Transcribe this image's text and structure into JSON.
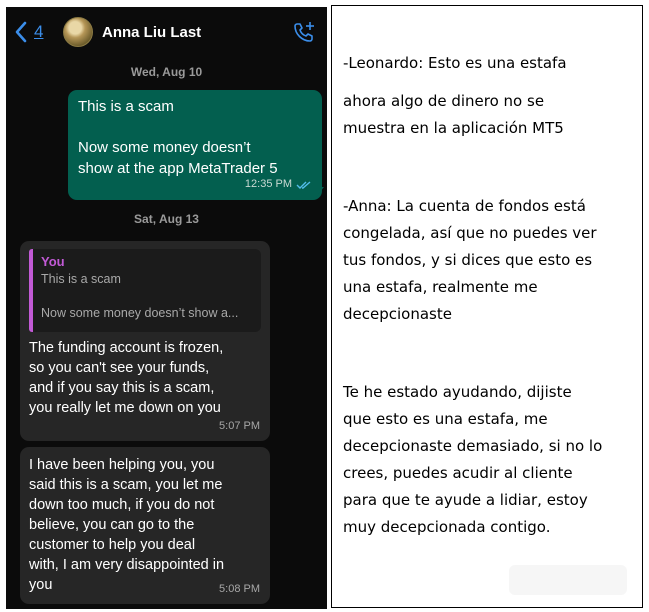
{
  "chat": {
    "header": {
      "back_count": "4",
      "contact_name": "Anna Liu Last",
      "icons": {
        "back": "chevron-left-icon",
        "call": "call-add-icon"
      },
      "accent_color": "#3b8eea"
    },
    "dates": [
      "Wed, Aug 10",
      "Sat, Aug 13"
    ],
    "outgoing": {
      "line1": "This is a scam",
      "line2": "Now  some money doesn’t",
      "line3": "show  at the app MetaTrader 5",
      "time": "12:35 PM",
      "status_icon": "double-check-icon",
      "bubble_color": "#035f4f"
    },
    "incoming1": {
      "quote_sender": "You",
      "quote_line1": "This is a scam",
      "quote_line2": "Now  some money doesn’t show  a...",
      "lines": [
        "The funding account is frozen,",
        "so you can't see your funds,",
        "and if you say this is a scam,",
        "you really let me down on you"
      ],
      "time": "5:07 PM"
    },
    "incoming2": {
      "lines": [
        "I have been helping you, you",
        "said this is a scam, you let me",
        "down too much, if you do not",
        "believe, you can go to the",
        "customer to help you deal",
        "with, I am very disappointed in",
        "you"
      ],
      "time": "5:08 PM"
    }
  },
  "translation": {
    "p1": [
      "-Leonardo: Esto es una estafa"
    ],
    "p2": [
      "ahora algo de dinero no se",
      "muestra en la aplicación MT5"
    ],
    "p3": [
      "-Anna: La cuenta de fondos está",
      "congelada, así que no puedes ver",
      "tus fondos, y si dices que esto es",
      "una estafa, realmente me",
      "decepcionaste"
    ],
    "p4": [
      "Te he estado ayudando, dijiste",
      "que esto es una estafa, me",
      "decepcionaste demasiado, si no lo",
      "crees, puedes acudir al cliente",
      "para que te ayude a lidiar, estoy",
      "muy decepcionada contigo."
    ]
  }
}
